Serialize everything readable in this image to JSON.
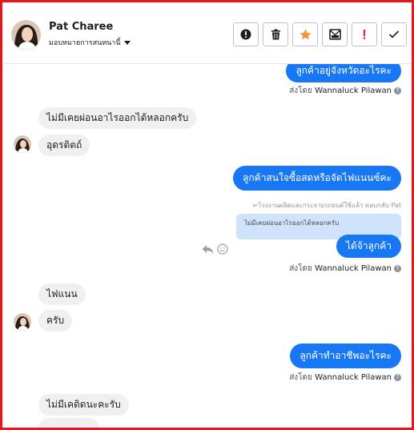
{
  "header": {
    "name": "Pat Charee",
    "assign_label": "มอบหมายการสนทนานี้",
    "actions": [
      {
        "name": "report-button",
        "icon": "alert-circle-icon"
      },
      {
        "name": "delete-button",
        "icon": "trash-icon"
      },
      {
        "name": "star-button",
        "icon": "star-icon"
      },
      {
        "name": "mark-unread-button",
        "icon": "mail-icon"
      },
      {
        "name": "important-button",
        "icon": "exclamation-icon"
      },
      {
        "name": "done-button",
        "icon": "check-icon"
      }
    ]
  },
  "messages": {
    "m1": "ลูกค้าอยู่จังหวัดอะไรคะ",
    "m1_sent_by": "ส่งโดย",
    "m1_sender": "Wannaluck Pilawan",
    "m2": "ไม่มีเคยผ่อนอาไรออกได้หลอกครับ",
    "m3": "อุดรดิตถ์",
    "m4": "ลูกค้าสนใจซื้อสดหรือจัดไฟแนนซ์คะ",
    "reply_note": "↩โรงงานผลิตและกระจายรถยนต์ใช้แล้ว ตอบกลับ Pat",
    "quoted": "ไม่มีเคยผ่อนอาไรออกได้หลอกครับ",
    "m5": "ได้จ้าลูกค้า",
    "m5_sent_by": "ส่งโดย",
    "m5_sender": "Wannaluck Pilawan",
    "m6": "ไฟแนน",
    "m7": "ครับ",
    "m8": "ลูกค้าทำอาชีพอะไรคะ",
    "m8_sent_by": "ส่งโดย",
    "m8_sender": "Wannaluck Pilawan",
    "m9": "ไม่มีเคดิดนะคะรับ"
  },
  "colors": {
    "border": "#e8151b",
    "outgoing": "#1877f2",
    "incoming": "#f0f0f0",
    "star": "#f7923a",
    "important": "#e0245e"
  }
}
